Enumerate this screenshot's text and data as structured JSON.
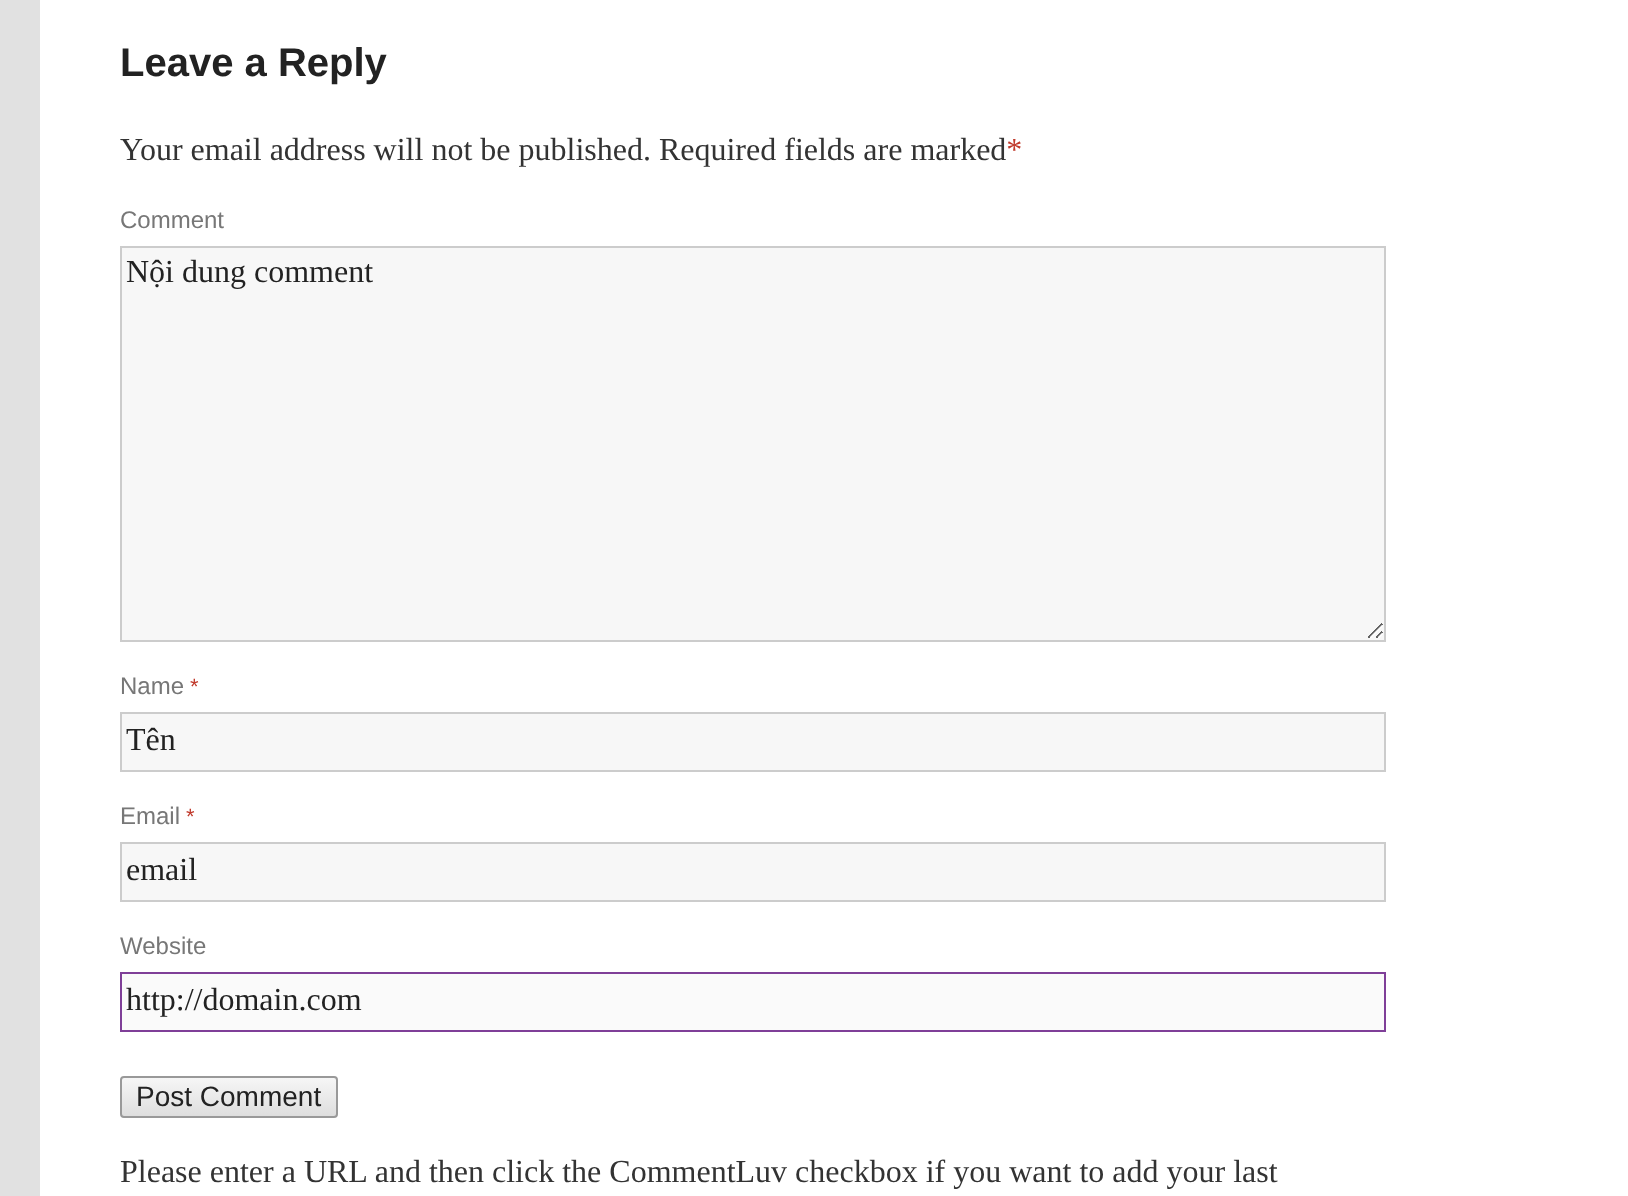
{
  "heading": "Leave a Reply",
  "note": {
    "text": "Your email address will not be published. Required fields are marked",
    "required_mark": "*"
  },
  "fields": [
    {
      "kind": "textarea",
      "label": "Comment",
      "required": false,
      "focused": false,
      "value": "Nội dung comment"
    },
    {
      "kind": "text",
      "label": "Name",
      "required": true,
      "focused": false,
      "value": "Tên"
    },
    {
      "kind": "text",
      "label": "Email",
      "required": true,
      "focused": false,
      "value": "email"
    },
    {
      "kind": "text",
      "label": "Website",
      "required": false,
      "focused": true,
      "value": "http://domain.com"
    }
  ],
  "required_mark": "*",
  "submit_button": "Post Comment",
  "footer_note": "Please enter a URL and then click the CommentLuv checkbox if you want to add your last"
}
